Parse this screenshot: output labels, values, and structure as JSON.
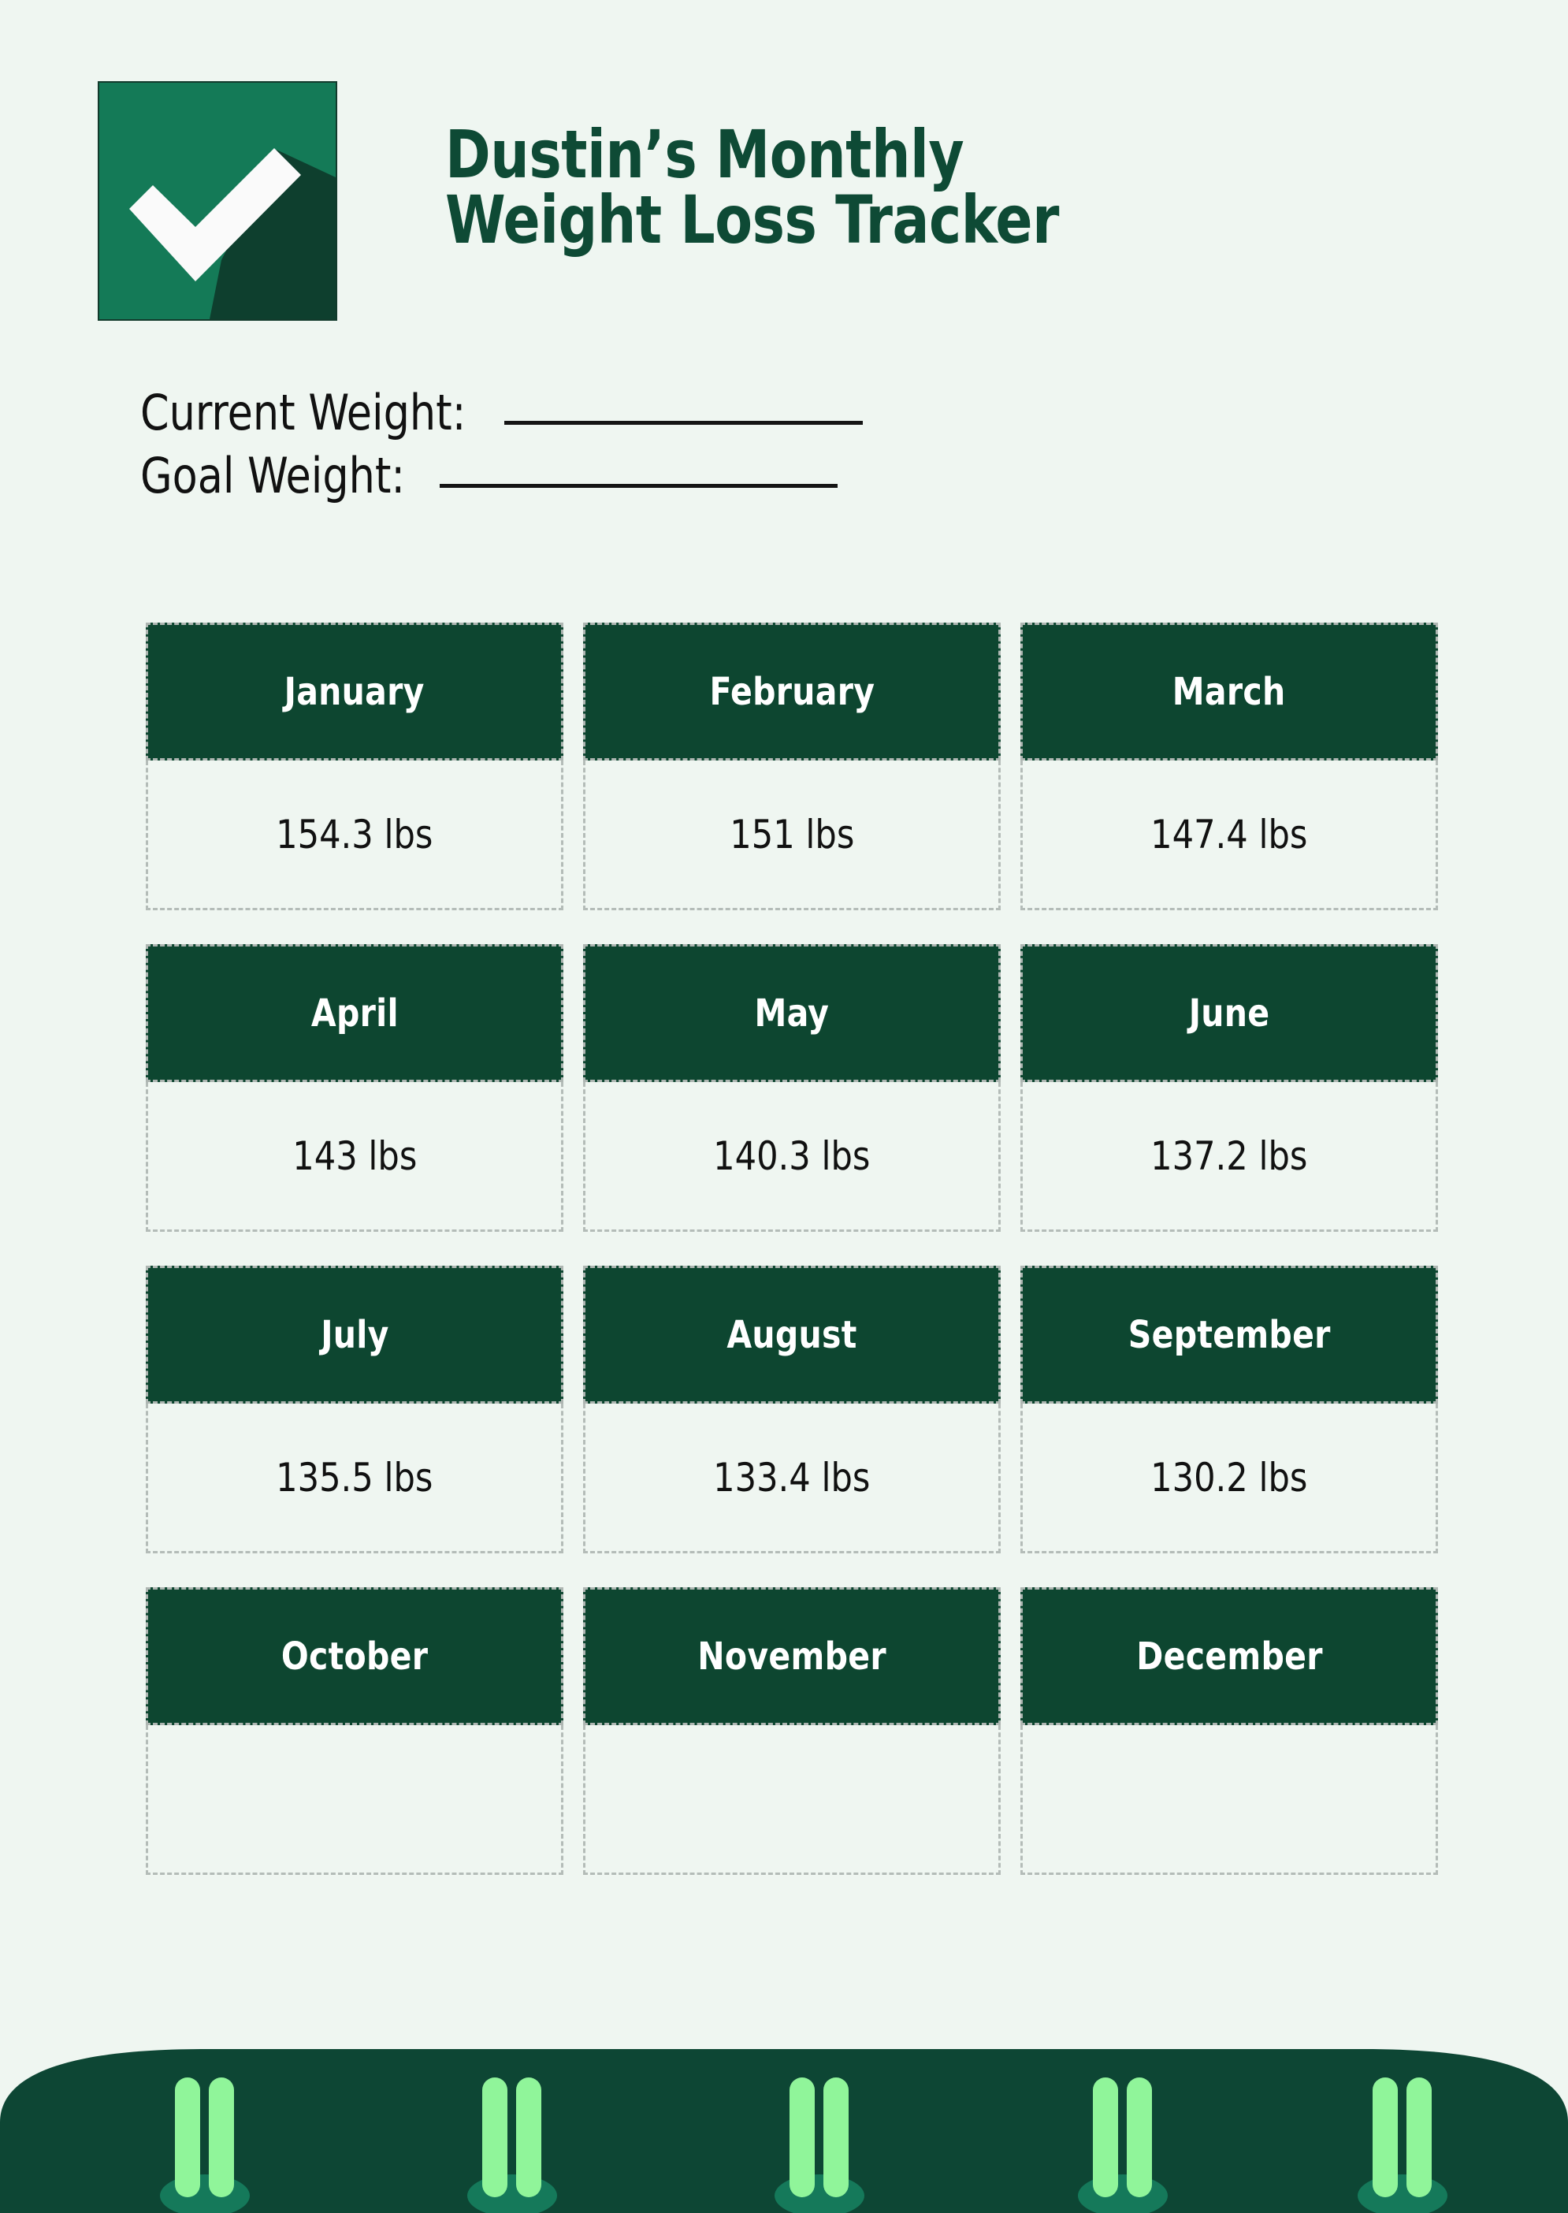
{
  "page": {
    "background_color": "#eff6f1",
    "accent_dark_green": "#0d4630",
    "accent_green": "#147a57",
    "accent_light_green": "#90f59a",
    "text_color": "#111111"
  },
  "header": {
    "logo_icon": "checkmark-square-icon",
    "title_line1": "Dustin’s Monthly",
    "title_line2": "Weight Loss Tracker"
  },
  "weights": {
    "current_label": "Current Weight:",
    "current_value": "",
    "goal_label": "Goal Weight:",
    "goal_value": ""
  },
  "grid": {
    "unit": "lbs",
    "rows": [
      [
        {
          "month": "January",
          "value": "154.3 lbs"
        },
        {
          "month": "February",
          "value": "151 lbs"
        },
        {
          "month": "March",
          "value": "147.4 lbs"
        }
      ],
      [
        {
          "month": "April",
          "value": "143 lbs"
        },
        {
          "month": "May",
          "value": "140.3 lbs"
        },
        {
          "month": "June",
          "value": "137.2 lbs"
        }
      ],
      [
        {
          "month": "July",
          "value": "135.5 lbs"
        },
        {
          "month": "August",
          "value": "133.4 lbs"
        },
        {
          "month": "September",
          "value": "130.2 lbs"
        }
      ],
      [
        {
          "month": "October",
          "value": ""
        },
        {
          "month": "November",
          "value": ""
        },
        {
          "month": "December",
          "value": ""
        }
      ]
    ]
  },
  "footer": {
    "decoration": "grass-hill-decoration",
    "hill_color": "#0d4634",
    "blade_color": "#90f59a",
    "blade_shadow_color": "#15795a",
    "blade_cluster_count": 5
  }
}
